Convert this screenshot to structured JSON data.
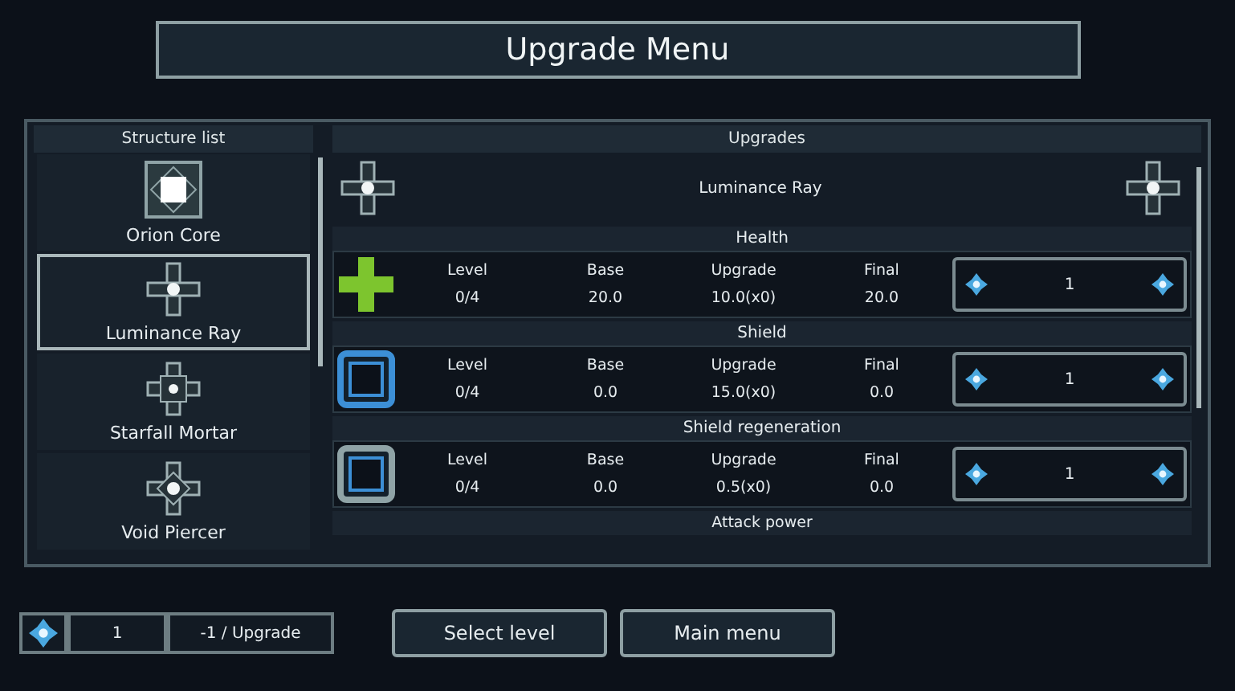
{
  "title": "Upgrade Menu",
  "structure_list": {
    "heading": "Structure list",
    "items": [
      {
        "name": "Orion Core",
        "kind": "core",
        "selected": false
      },
      {
        "name": "Luminance Ray",
        "kind": "ray",
        "selected": true
      },
      {
        "name": "Starfall Mortar",
        "kind": "mortar",
        "selected": false
      },
      {
        "name": "Void Piercer",
        "kind": "piercer",
        "selected": false
      }
    ]
  },
  "upgrades": {
    "heading": "Upgrades",
    "structure": "Luminance Ray",
    "stats": [
      {
        "name": "Health",
        "kind": "health",
        "columns": [
          {
            "label": "Level",
            "value": "0/4"
          },
          {
            "label": "Base",
            "value": "20.0"
          },
          {
            "label": "Upgrade",
            "value": "10.0(x0)"
          },
          {
            "label": "Final",
            "value": "20.0"
          }
        ],
        "amount": "1"
      },
      {
        "name": "Shield",
        "kind": "shield",
        "columns": [
          {
            "label": "Level",
            "value": "0/4"
          },
          {
            "label": "Base",
            "value": "0.0"
          },
          {
            "label": "Upgrade",
            "value": "15.0(x0)"
          },
          {
            "label": "Final",
            "value": "0.0"
          }
        ],
        "amount": "1"
      },
      {
        "name": "Shield regeneration",
        "kind": "regen",
        "columns": [
          {
            "label": "Level",
            "value": "0/4"
          },
          {
            "label": "Base",
            "value": "0.0"
          },
          {
            "label": "Upgrade",
            "value": "0.5(x0)"
          },
          {
            "label": "Final",
            "value": "0.0"
          }
        ],
        "amount": "1"
      },
      {
        "name": "Attack power",
        "kind": "header"
      }
    ]
  },
  "footer": {
    "points": "1",
    "cost": "-1 / Upgrade",
    "buttons": [
      "Select level",
      "Main menu"
    ]
  }
}
